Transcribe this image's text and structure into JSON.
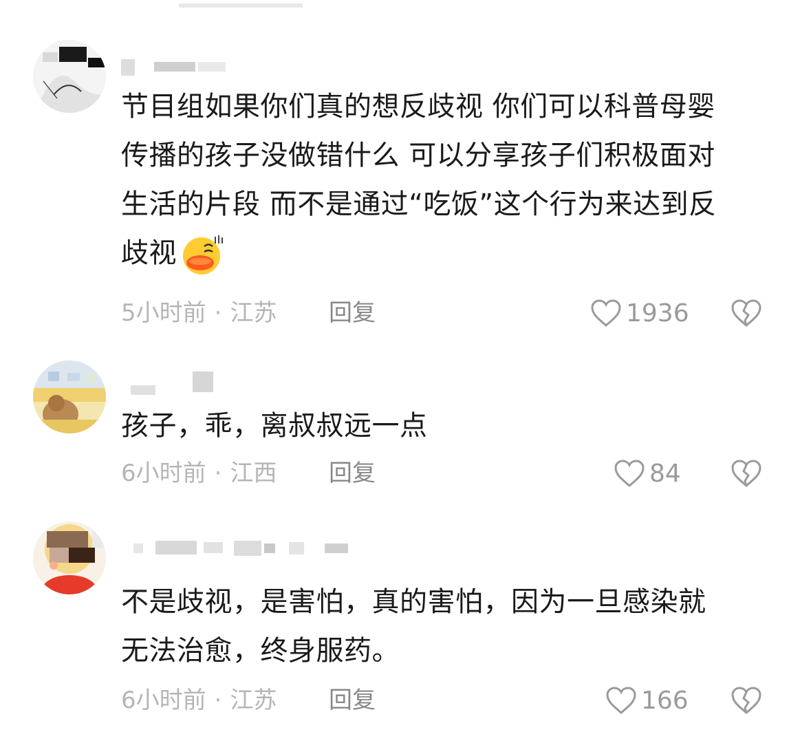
{
  "comments": [
    {
      "text": "节目组如果你们真的想反歧视 你们可以科普母婴传播的孩子没做错什么 可以分享孩子们积极面对生活的片段 而不是通过“吃饭”这个行为来达到反歧视",
      "lines": [
        "节目组如果你们真的想反歧视 你们可以科普母婴",
        "传播的孩子没做错什么 可以分享孩子们积极面对",
        "生活的片段 而不是通过“吃饭”这个行为来达到反",
        "歧视"
      ],
      "emoji": "smiling-duck-emoji",
      "time": "5小时前",
      "location": "江苏",
      "reply_label": "回复",
      "likes": "1936"
    },
    {
      "text": "孩子，乖，离叔叔远一点",
      "lines": [
        "孩子，乖，离叔叔远一点"
      ],
      "time": "6小时前",
      "location": "江西",
      "reply_label": "回复",
      "likes": "84"
    },
    {
      "text": "不是歧视，是害怕，真的害怕，因为一旦感染就无法治愈，终身服药。",
      "lines": [
        "不是歧视，是害怕，真的害怕，因为一旦感染就",
        "无法治愈，终身服药。"
      ],
      "time": "6小时前",
      "location": "江苏",
      "reply_label": "回复",
      "likes": "166"
    }
  ],
  "meta_separator": "·",
  "icons": {
    "like": "heart-outline-icon",
    "dislike": "broken-heart-icon"
  },
  "colors": {
    "text": "#1a1a1a",
    "meta": "#b5b5b5",
    "reply": "#888888",
    "icon": "#9a9a9a"
  }
}
